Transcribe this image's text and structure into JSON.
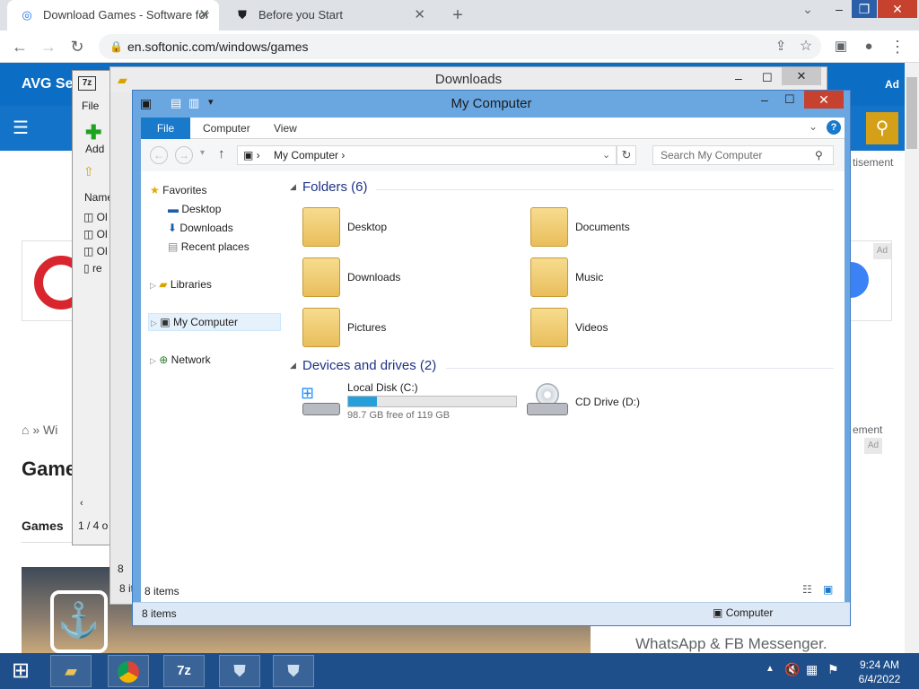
{
  "browser": {
    "tabs": [
      {
        "title": "Download Games - Software for"
      },
      {
        "title": "Before you Start"
      }
    ],
    "url": "en.softonic.com/windows/games"
  },
  "website": {
    "brand_text": "AVG Se",
    "ad_label": "Ad",
    "advertisement": "tisement",
    "advertisement2": "ement",
    "breadcrumb": "Wi",
    "heading": "Game",
    "subnav": "Games",
    "whatsapp": "WhatsApp & FB Messenger."
  },
  "sevenzip": {
    "logo": "7z",
    "menu_file": "File",
    "add_label": "Add",
    "col_name": "Name",
    "rows": [
      "Ol",
      "Ol",
      "Ol",
      "re"
    ],
    "status": "1 / 4 o",
    "status2": "8 it",
    "partial": "8"
  },
  "downloads_window": {
    "title": "Downloads"
  },
  "explorer": {
    "title": "My Computer",
    "ribbon_tabs": [
      "File",
      "Computer",
      "View"
    ],
    "path": "My Computer",
    "search_placeholder": "Search My Computer",
    "nav": {
      "favorites": "Favorites",
      "desktop": "Desktop",
      "downloads": "Downloads",
      "recent": "Recent places",
      "libraries": "Libraries",
      "my_computer": "My Computer",
      "network": "Network"
    },
    "folders_title": "Folders (6)",
    "folders": [
      "Desktop",
      "Documents",
      "Downloads",
      "Music",
      "Pictures",
      "Videos"
    ],
    "devices_title": "Devices and drives (2)",
    "drive_c": {
      "name": "Local Disk (C:)",
      "free": "98.7 GB free of 119 GB",
      "used_fraction": 0.17
    },
    "drive_d": {
      "name": "CD Drive (D:)"
    },
    "items_inner": "8 items",
    "items_outer": "8 items",
    "status_location": "Computer"
  },
  "taskbar": {
    "time": "9:24 AM",
    "date": "6/4/2022"
  },
  "colors": {
    "accent": "#1979ca",
    "taskbar": "#1f4f8a",
    "site_blue": "#0b6dc4"
  }
}
